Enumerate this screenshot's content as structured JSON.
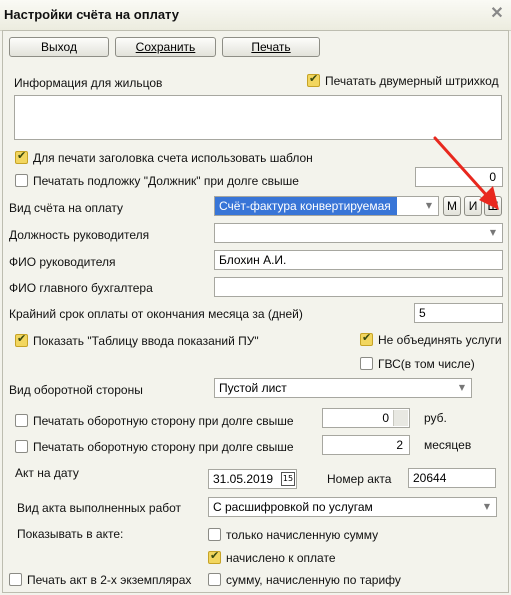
{
  "window": {
    "title": "Настройки счёта на оплату"
  },
  "toolbar": {
    "exit_label": "Выход",
    "save_label": "Сохранить",
    "print_label": "Печать"
  },
  "residents_info": {
    "label": "Информация для жильцов",
    "print_barcode_label": "Печатать двумерный штрихкод",
    "print_barcode_checked": true
  },
  "header_template": {
    "label": "Для печати заголовка счета использовать шаблон",
    "checked": true
  },
  "debtor_background": {
    "label": "Печатать подложку \"Должник\" при долге свыше",
    "checked": false,
    "value": "0"
  },
  "invoice_type": {
    "label": "Вид счёта на оплату",
    "value": "Счёт-фактура конвертируемая",
    "btn_m": "М",
    "btn_i": "И",
    "btn_sh": "Ш"
  },
  "head_position": {
    "label": "Должность руководителя",
    "value": ""
  },
  "head_name": {
    "label": "ФИО руководителя",
    "value": "Блохин А.И."
  },
  "chief_accountant": {
    "label": "ФИО главного бухгалтера",
    "value": ""
  },
  "deadline": {
    "label": "Крайний срок оплаты от окончания месяца за (дней)",
    "value": "5"
  },
  "meter_table": {
    "label": "Показать \"Таблицу ввода показаний ПУ\"",
    "checked": true
  },
  "no_merge_services": {
    "label": "Не объединять услуги",
    "checked": true
  },
  "gvs": {
    "label": "ГВС(в том числе)",
    "checked": false
  },
  "back_side": {
    "label": "Вид оборотной стороны",
    "value": "Пустой лист"
  },
  "print_back_rub": {
    "label": "Печатать оборотную сторону при долге свыше",
    "checked": false,
    "value": "0",
    "unit": "руб."
  },
  "print_back_months": {
    "label": "Печатать оборотную сторону при долге свыше",
    "checked": false,
    "value": "2",
    "unit": "месяцев"
  },
  "act_date": {
    "label": "Акт на дату",
    "value": "31.05.2019",
    "cal_text": "15",
    "number_label": "Номер акта",
    "number_value": "20644"
  },
  "act_type": {
    "label": "Вид акта выполненных работ",
    "value": "С расшифровкой по услугам"
  },
  "act_show": {
    "label": "Показывать в акте:",
    "opt1": "только начисленную сумму",
    "opt1_checked": false,
    "opt2": "начислено к оплате",
    "opt2_checked": true,
    "opt3": "сумму, начисленную по тарифу",
    "opt3_checked": false
  },
  "two_copies": {
    "label": "Печать акт в 2-х экземплярах",
    "checked": false
  },
  "colors": {
    "accent_selection": "#3875d7",
    "checkbox_checked": "#f2d65f",
    "annotation_arrow": "#e8281e"
  },
  "icons": {
    "close": "close-icon",
    "dropdown": "chevron-down-icon",
    "calendar": "calendar-icon",
    "annotation": "red-arrow"
  }
}
